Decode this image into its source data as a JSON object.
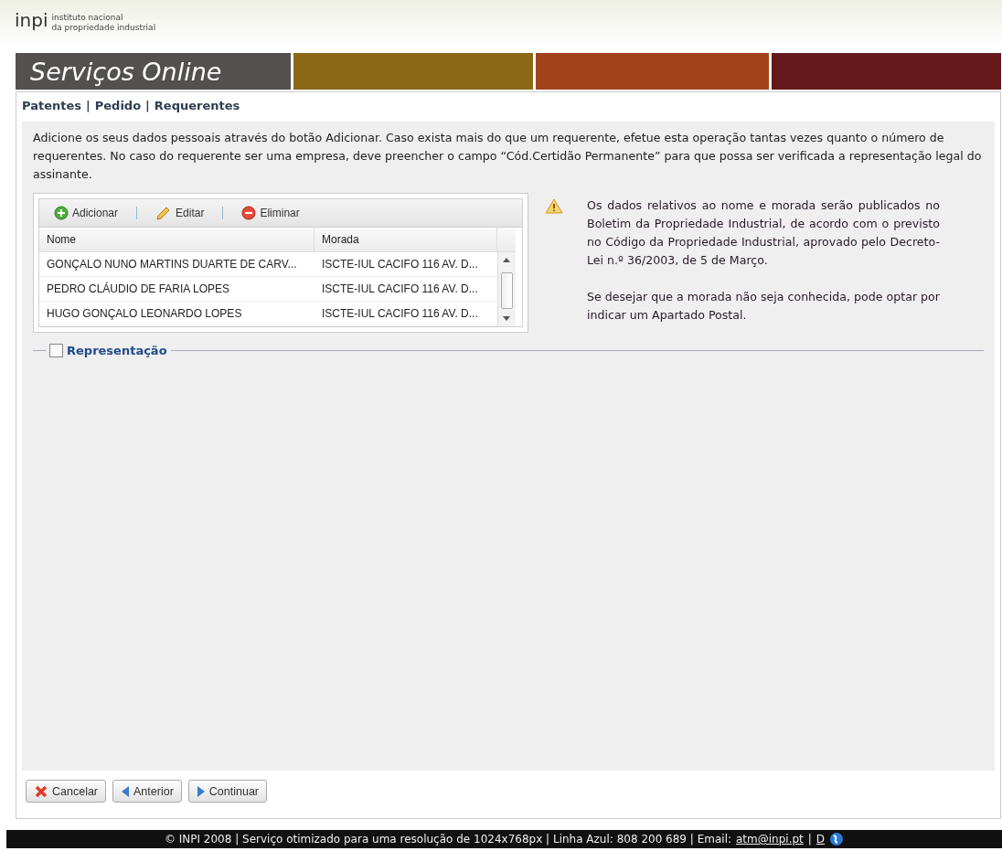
{
  "logo": {
    "mark": "inpi",
    "line_1": "instituto nacional",
    "line_2": "da propriedade industrial"
  },
  "banner": {
    "title": "Serviços Online"
  },
  "breadcrumb": [
    "Patentes",
    "|",
    "Pedido",
    "|",
    "Requerentes"
  ],
  "intro": "Adicione os seus dados pessoais através do botão Adicionar. Caso exista mais do que um requerente, efetue esta operação tantas vezes quanto o número de requerentes. No caso do requerente ser uma empresa, deve preencher o campo “Cód.Certidão Permanente” para que possa ser verificada a representação legal do assinante.",
  "toolbar": [
    {
      "kind": "add",
      "label": "Adicionar"
    },
    {
      "kind": "edit",
      "label": "Editar"
    },
    {
      "kind": "delete",
      "label": "Eliminar"
    }
  ],
  "table": {
    "columns": [
      "Nome",
      "Morada"
    ],
    "rows": [
      [
        "GONÇALO NUNO MARTINS DUARTE DE CARV...",
        "ISCTE-IUL CACIFO 116 AV. D..."
      ],
      [
        "PEDRO CLÁUDIO DE FARIA LOPES",
        "ISCTE-IUL CACIFO 116 AV. D..."
      ],
      [
        "HUGO GONÇALO LEONARDO LOPES",
        "ISCTE-IUL CACIFO 116 AV. D..."
      ]
    ]
  },
  "notice": [
    "Os dados relativos ao nome e morada serão publicados no Boletim da Propriedade Industrial, de acordo com o previsto no Código da Propriedade Industrial, aprovado pelo Decreto-Lei n.º 36/2003, de 5 de Março.",
    "Se desejar que a morada não seja conhecida, pode optar por indicar um Apartado Postal."
  ],
  "representacao": {
    "label": "Representação",
    "checked": false
  },
  "buttons": [
    {
      "kind": "cancel",
      "label": "Cancelar"
    },
    {
      "kind": "back",
      "label": "Anterior"
    },
    {
      "kind": "next",
      "label": "Continuar"
    }
  ],
  "footer": {
    "text": "© INPI 2008 | Serviço otimizado para uma resolução de 1024x768px | Linha Azul: 808 200 689 | Email:",
    "email": "atm@inpi.pt",
    "separator": "|",
    "cut": "D"
  }
}
